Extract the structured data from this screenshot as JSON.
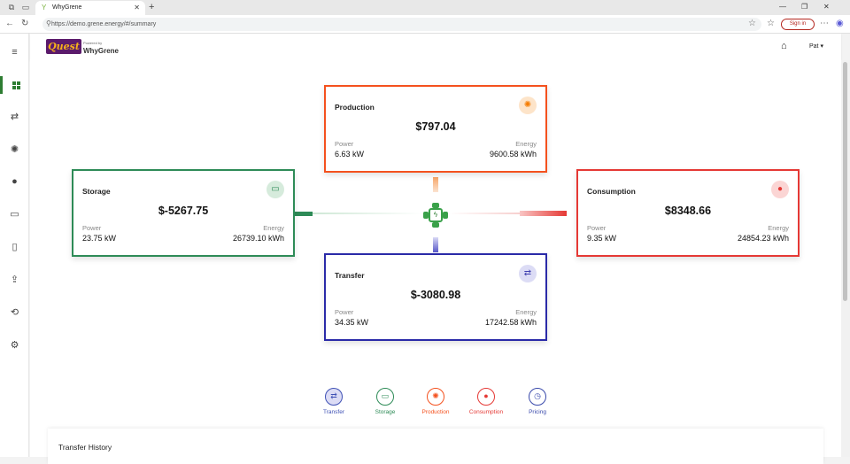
{
  "browser": {
    "tab_title": "WhyGrene",
    "url": "https://demo.grene.energy/#/summary",
    "sign_in": "Sign in"
  },
  "header": {
    "logo_text": "Quest",
    "powered_by": "Powered by",
    "brand": "WhyGrene",
    "user": "Pat"
  },
  "cards": {
    "production": {
      "title": "Production",
      "amount": "$797.04",
      "power_label": "Power",
      "power": "6.63 kW",
      "energy_label": "Energy",
      "energy": "9600.58 kWh",
      "color": "#f4511e"
    },
    "storage": {
      "title": "Storage",
      "amount": "$-5267.75",
      "power_label": "Power",
      "power": "23.75 kW",
      "energy_label": "Energy",
      "energy": "26739.10 kWh",
      "color": "#2e8b57"
    },
    "consumption": {
      "title": "Consumption",
      "amount": "$8348.66",
      "power_label": "Power",
      "power": "9.35 kW",
      "energy_label": "Energy",
      "energy": "24854.23 kWh",
      "color": "#e53935"
    },
    "transfer": {
      "title": "Transfer",
      "amount": "$-3080.98",
      "power_label": "Power",
      "power": "34.35 kW",
      "energy_label": "Energy",
      "energy": "17242.58 kWh",
      "color": "#2a2aa8"
    }
  },
  "legend": [
    {
      "label": "Transfer",
      "icon": "transfer-icon",
      "color": "#3f51b5"
    },
    {
      "label": "Storage",
      "icon": "battery-icon",
      "color": "#2e8b57"
    },
    {
      "label": "Production",
      "icon": "sun-icon",
      "color": "#f4511e"
    },
    {
      "label": "Consumption",
      "icon": "bulb-icon",
      "color": "#e53935"
    },
    {
      "label": "Pricing",
      "icon": "clock-icon",
      "color": "#3949ab"
    }
  ],
  "history": {
    "title": "Transfer History"
  }
}
